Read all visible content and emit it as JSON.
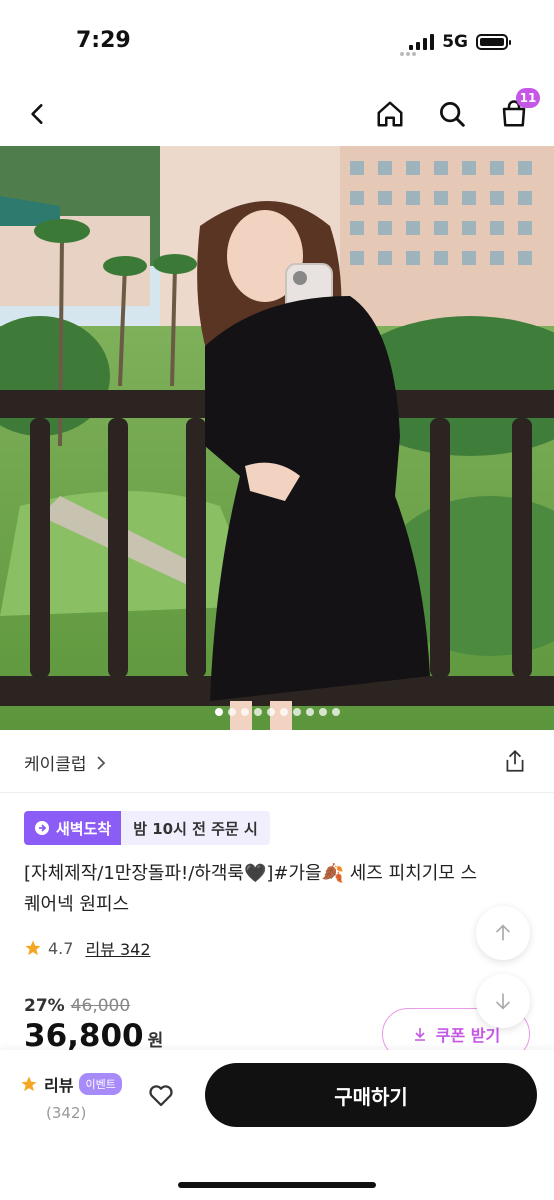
{
  "status": {
    "time": "7:29",
    "network": "5G"
  },
  "nav": {
    "cart_count": "11",
    "icons": [
      "back-icon",
      "home-icon",
      "search-icon",
      "cart-icon"
    ]
  },
  "carousel": {
    "count": 10,
    "active": 0
  },
  "brand": {
    "name": "케이클럽"
  },
  "badges": {
    "dawn": "새벽도착",
    "order_time": "밤 10시 전 주문 시"
  },
  "product": {
    "title_line1": "[자체제작/1만장돌파!/하객룩🖤]#가을🍂 세즈 피치기모 스",
    "title_line2": "퀘어넥 원피스",
    "rating": "4.7",
    "review_link": "리뷰 342",
    "discount_rate": "27%",
    "original_price": "46,000",
    "price": "36,800",
    "currency": "원"
  },
  "coupon": {
    "label": "쿠폰 받기"
  },
  "bottom": {
    "review_label": "리뷰",
    "event_badge": "이벤트",
    "review_count": "(342)",
    "buy_label": "구매하기"
  },
  "colors": {
    "accent": "#8b5cf6",
    "coupon": "#c657e6",
    "badge_pink": "#c657e6",
    "buy_button": "#111111"
  }
}
